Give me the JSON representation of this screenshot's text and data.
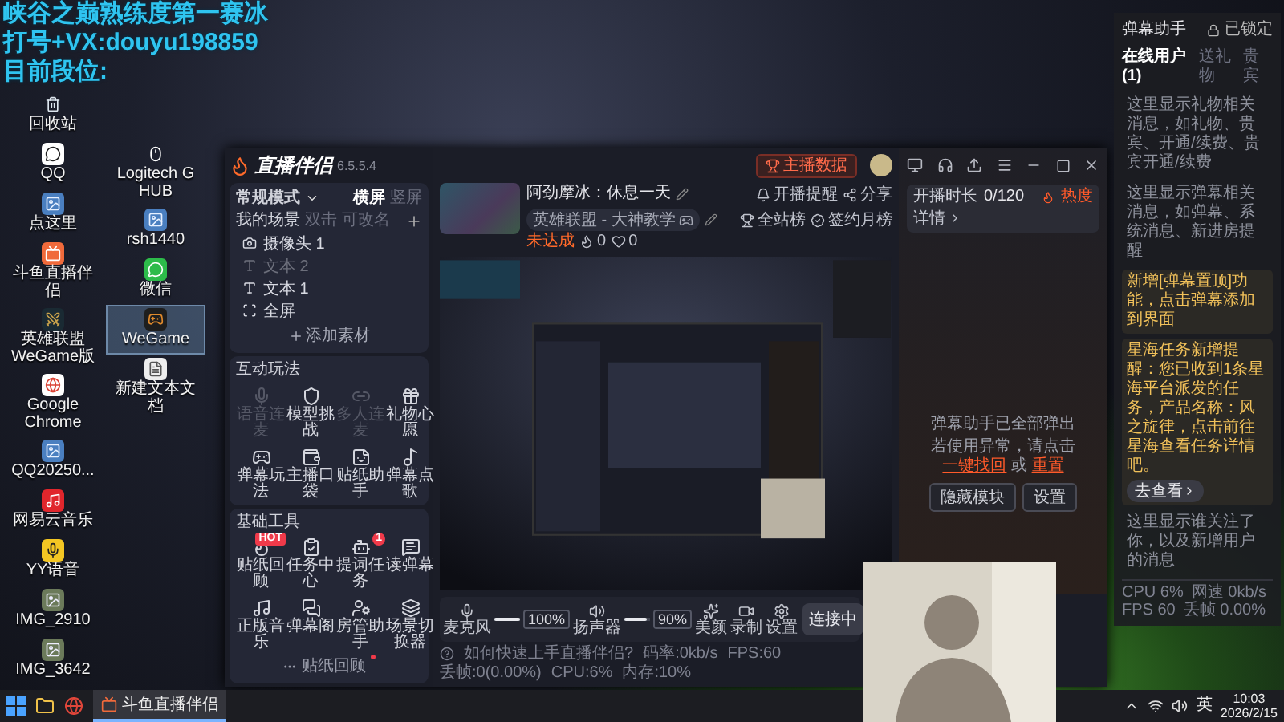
{
  "overlay_lines": [
    "峡谷之巅熟练度第一赛冰",
    "打号+VX:douyu198859",
    "目前段位:"
  ],
  "desktop_columns": [
    [
      {
        "label": "回收站",
        "kind": "bin",
        "selected": false
      },
      {
        "label": "QQ",
        "kind": "qq",
        "selected": false
      },
      {
        "label": "点这里",
        "kind": "picture",
        "selected": false
      },
      {
        "label": "斗鱼直播伴侣",
        "kind": "douyu",
        "selected": false
      },
      {
        "label": "英雄联盟 WeGame版",
        "kind": "lol",
        "selected": false
      },
      {
        "label": "Google Chrome",
        "kind": "chrome",
        "selected": false
      },
      {
        "label": "QQ20250...",
        "kind": "picture",
        "selected": false
      },
      {
        "label": "网易云音乐",
        "kind": "music",
        "selected": false
      },
      {
        "label": "YY语音",
        "kind": "yy",
        "selected": false
      },
      {
        "label": "IMG_2910",
        "kind": "photo",
        "selected": false
      },
      {
        "label": "IMG_3642",
        "kind": "photo",
        "selected": false
      }
    ],
    [
      {
        "label": "Logitech G HUB",
        "kind": "ghub",
        "selected": false
      },
      {
        "label": "rsh1440",
        "kind": "picture",
        "selected": false
      },
      {
        "label": "微信",
        "kind": "wechat",
        "selected": false
      },
      {
        "label": "WeGame",
        "kind": "wegame",
        "selected": true
      },
      {
        "label": "新建文本文档",
        "kind": "text",
        "selected": false
      }
    ]
  ],
  "app": {
    "name": "直播伴侣",
    "version": "6.5.5.4",
    "mode": "常规模式",
    "orientation_tabs": [
      {
        "label": "横屏",
        "selected": true
      },
      {
        "label": "竖屏",
        "selected": false
      }
    ],
    "scene_header": {
      "title": "我的场景",
      "hint_1": "双击",
      "hint_2": "可改名"
    },
    "sources": [
      {
        "label": "摄像头 1",
        "kind": "camera",
        "visible": true
      },
      {
        "label": "文本 2",
        "kind": "text",
        "visible": false
      },
      {
        "label": "文本 1",
        "kind": "text",
        "visible": true
      },
      {
        "label": "全屏",
        "kind": "screen",
        "visible": true
      }
    ],
    "add_source": "添加素材",
    "sections": [
      {
        "title": "互动玩法",
        "tools": [
          {
            "label": "语音连麦",
            "kind": "mic",
            "disabled": true
          },
          {
            "label": "模型挑战",
            "kind": "shield",
            "disabled": false
          },
          {
            "label": "多人连麦",
            "kind": "link",
            "disabled": true
          },
          {
            "label": "礼物心愿",
            "kind": "gift",
            "disabled": false
          },
          {
            "label": "弹幕玩法",
            "kind": "gamepad",
            "disabled": false
          },
          {
            "label": "主播口袋",
            "kind": "wallet",
            "disabled": false
          },
          {
            "label": "贴纸助手",
            "kind": "sticker",
            "disabled": false
          },
          {
            "label": "弹幕点歌",
            "kind": "song",
            "disabled": false
          }
        ]
      },
      {
        "title": "基础工具",
        "more": "贴纸回顾",
        "tools": [
          {
            "label": "贴纸回顾",
            "kind": "flame",
            "disabled": false,
            "badge": "HOT"
          },
          {
            "label": "任务中心",
            "kind": "task",
            "disabled": false
          },
          {
            "label": "提词任务",
            "kind": "ai",
            "disabled": false,
            "badge": "1"
          },
          {
            "label": "读弹幕",
            "kind": "read",
            "disabled": false
          },
          {
            "label": "正版音乐",
            "kind": "music",
            "disabled": false
          },
          {
            "label": "弹幕阁",
            "kind": "barrage",
            "disabled": false
          },
          {
            "label": "房管助手",
            "kind": "admin",
            "disabled": false
          },
          {
            "label": "场景切换器",
            "kind": "switch",
            "disabled": false
          }
        ]
      }
    ]
  },
  "topbar": {
    "data_button": "主播数据"
  },
  "room": {
    "title": "阿劲摩冰：休息一天",
    "category": "英雄联盟 - 大神教学",
    "remind": "开播提醒",
    "share": "分享",
    "rank": "全站榜",
    "monthly": "签约月榜",
    "status": "未达成",
    "flames": "0",
    "likes": "0"
  },
  "controls": {
    "mic": {
      "label": "麦克风",
      "level": 1,
      "reading": "100%"
    },
    "speaker": {
      "label": "扬声器",
      "level": 0.9,
      "reading": "90%"
    },
    "buttons": [
      {
        "label": "美颜",
        "kind": "beauty"
      },
      {
        "label": "录制",
        "kind": "record"
      },
      {
        "label": "设置",
        "kind": "settings"
      }
    ],
    "connect": "连接中"
  },
  "status": {
    "hint": "如何快速上手直播伴侣?",
    "stats": [
      "码率:0kb/s",
      "FPS:60",
      "丢帧:0(0.00%)",
      "CPU:6%",
      "内存:10%"
    ]
  },
  "side": {
    "duration_label": "开播时长",
    "duration": "0/120",
    "heat": "热度",
    "details": "详情",
    "notice": "弹幕助手已全部弹出",
    "help_prefix": "若使用异常，请点击",
    "link_1": "一键找回",
    "help_mid": "或",
    "link_2": "重置",
    "buttons": [
      "隐藏模块",
      "设置"
    ]
  },
  "widget": {
    "title": "弹幕助手",
    "lock": "已锁定",
    "tabs": [
      {
        "label": "在线用户(1)",
        "selected": true
      },
      {
        "label": "送礼物",
        "selected": false
      },
      {
        "label": "贵宾",
        "selected": false
      }
    ],
    "messages": [
      {
        "kind": "plain",
        "text": "这里显示礼物相关消息，如礼物、贵宾、开通/续费、贵宾开通/续费"
      },
      {
        "kind": "plain",
        "text": "这里显示弹幕相关消息，如弹幕、系统消息、新进房提醒"
      },
      {
        "kind": "highlight",
        "text": "新增[弹幕置顶]功能，点击弹幕添加到界面"
      },
      {
        "kind": "task",
        "text": "星海任务新增提醒：您已收到1条星海平台派发的任务，产品名称：风之旋律，点击前往星海查看任务详情吧。",
        "action": "去查看"
      },
      {
        "kind": "plain",
        "text": "这里显示谁关注了你，以及新增用户的消息"
      }
    ],
    "stats": [
      "CPU 6%",
      "网速 0kb/s",
      "FPS 60",
      "丢帧 0.00%"
    ]
  },
  "taskbar": {
    "app": {
      "label": "斗鱼直播伴侣",
      "selected": true
    },
    "ime": "英",
    "time": "10:03",
    "date": "2026/2/15"
  }
}
